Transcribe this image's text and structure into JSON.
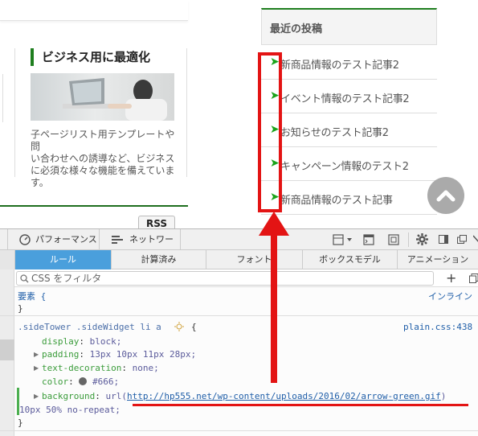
{
  "site": {
    "section_title": "ビジネス用に最適化",
    "section_desc": [
      "子ページリスト用テンプレートや問",
      "い合わせへの誘導など、ビジネス",
      "に必須な様々な機能を備えていま",
      "す。"
    ],
    "rss_label": "RSS"
  },
  "sidebar": {
    "widget_title": "最近の投稿",
    "posts": [
      "新商品情報のテスト記事2",
      "イベント情報のテスト記事2",
      "お知らせのテスト記事2",
      "キャンペーン情報のテスト2",
      "新商品情報のテスト記事"
    ],
    "arrow_glyph": "➤"
  },
  "devtools": {
    "toolbar": {
      "performance_label": "パフォーマンス",
      "network_label": "ネットワーク"
    },
    "subtabs": [
      "ルール",
      "計算済み",
      "フォント",
      "ボックスモデル",
      "アニメーション"
    ],
    "active_subtab": "ルール",
    "filter_placeholder": "CSS をフィルタ",
    "rules": {
      "element_selector": "要素 {",
      "element_close": "}",
      "inline_label": "インライン",
      "selector": ".sideTower .sideWidget li a",
      "source": "plain.css:438",
      "declarations": [
        {
          "prop": "display",
          "value": "block;"
        },
        {
          "prop": "padding",
          "value": "13px 10px 11px 28px;"
        },
        {
          "prop": "text-decoration",
          "value": "none;"
        },
        {
          "prop": "color",
          "value": "#666;"
        }
      ],
      "background_prop": "background",
      "background_url_open": "url(",
      "background_url": "http://hp555.net/wp-content/uploads/2016/02/arrow-green.gif",
      "background_url_close": ")",
      "background_rest": "10px 50% no-repeat;",
      "close": "}"
    }
  },
  "colors": {
    "green_accent": "#1e7e1e",
    "annotation_red": "#e31414",
    "active_tab": "#4a9fdc"
  }
}
